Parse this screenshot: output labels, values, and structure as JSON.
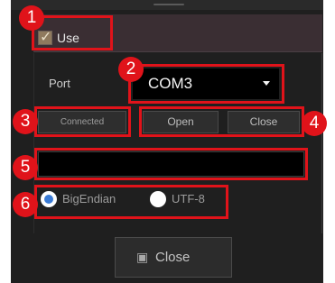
{
  "use_checkbox": {
    "label": "Use",
    "checked": true
  },
  "port": {
    "label": "Port",
    "value": "COM3"
  },
  "buttons": {
    "connected": "Connected",
    "open": "Open",
    "close": "Close"
  },
  "text_field": {
    "value": ""
  },
  "encoding": {
    "options": [
      "BigEndian",
      "UTF-8"
    ],
    "selected": "BigEndian"
  },
  "bottom": {
    "close_label": "Close",
    "close_icon": "close-window-icon"
  },
  "callouts": [
    "1",
    "2",
    "3",
    "4",
    "5",
    "6"
  ],
  "colors": {
    "highlight": "#e0131a",
    "background": "#1f1f1f"
  }
}
